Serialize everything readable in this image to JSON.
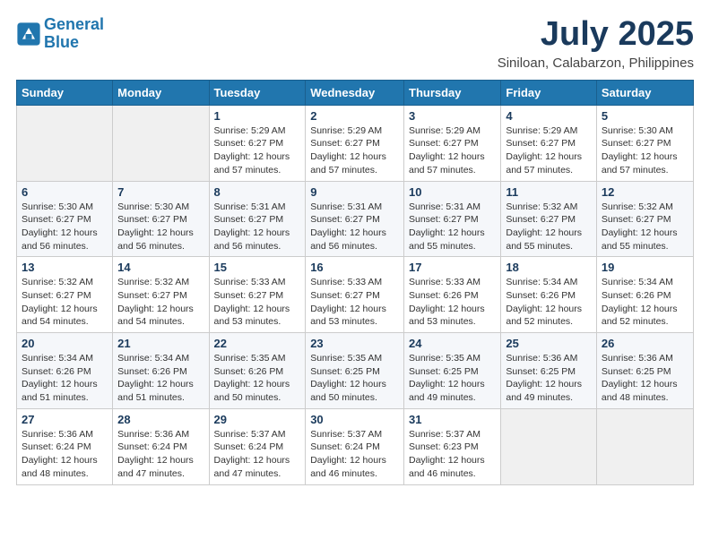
{
  "header": {
    "logo_line1": "General",
    "logo_line2": "Blue",
    "month": "July 2025",
    "location": "Siniloan, Calabarzon, Philippines"
  },
  "weekdays": [
    "Sunday",
    "Monday",
    "Tuesday",
    "Wednesday",
    "Thursday",
    "Friday",
    "Saturday"
  ],
  "weeks": [
    [
      {
        "day": "",
        "info": ""
      },
      {
        "day": "",
        "info": ""
      },
      {
        "day": "1",
        "info": "Sunrise: 5:29 AM\nSunset: 6:27 PM\nDaylight: 12 hours\nand 57 minutes."
      },
      {
        "day": "2",
        "info": "Sunrise: 5:29 AM\nSunset: 6:27 PM\nDaylight: 12 hours\nand 57 minutes."
      },
      {
        "day": "3",
        "info": "Sunrise: 5:29 AM\nSunset: 6:27 PM\nDaylight: 12 hours\nand 57 minutes."
      },
      {
        "day": "4",
        "info": "Sunrise: 5:29 AM\nSunset: 6:27 PM\nDaylight: 12 hours\nand 57 minutes."
      },
      {
        "day": "5",
        "info": "Sunrise: 5:30 AM\nSunset: 6:27 PM\nDaylight: 12 hours\nand 57 minutes."
      }
    ],
    [
      {
        "day": "6",
        "info": "Sunrise: 5:30 AM\nSunset: 6:27 PM\nDaylight: 12 hours\nand 56 minutes."
      },
      {
        "day": "7",
        "info": "Sunrise: 5:30 AM\nSunset: 6:27 PM\nDaylight: 12 hours\nand 56 minutes."
      },
      {
        "day": "8",
        "info": "Sunrise: 5:31 AM\nSunset: 6:27 PM\nDaylight: 12 hours\nand 56 minutes."
      },
      {
        "day": "9",
        "info": "Sunrise: 5:31 AM\nSunset: 6:27 PM\nDaylight: 12 hours\nand 56 minutes."
      },
      {
        "day": "10",
        "info": "Sunrise: 5:31 AM\nSunset: 6:27 PM\nDaylight: 12 hours\nand 55 minutes."
      },
      {
        "day": "11",
        "info": "Sunrise: 5:32 AM\nSunset: 6:27 PM\nDaylight: 12 hours\nand 55 minutes."
      },
      {
        "day": "12",
        "info": "Sunrise: 5:32 AM\nSunset: 6:27 PM\nDaylight: 12 hours\nand 55 minutes."
      }
    ],
    [
      {
        "day": "13",
        "info": "Sunrise: 5:32 AM\nSunset: 6:27 PM\nDaylight: 12 hours\nand 54 minutes."
      },
      {
        "day": "14",
        "info": "Sunrise: 5:32 AM\nSunset: 6:27 PM\nDaylight: 12 hours\nand 54 minutes."
      },
      {
        "day": "15",
        "info": "Sunrise: 5:33 AM\nSunset: 6:27 PM\nDaylight: 12 hours\nand 53 minutes."
      },
      {
        "day": "16",
        "info": "Sunrise: 5:33 AM\nSunset: 6:27 PM\nDaylight: 12 hours\nand 53 minutes."
      },
      {
        "day": "17",
        "info": "Sunrise: 5:33 AM\nSunset: 6:26 PM\nDaylight: 12 hours\nand 53 minutes."
      },
      {
        "day": "18",
        "info": "Sunrise: 5:34 AM\nSunset: 6:26 PM\nDaylight: 12 hours\nand 52 minutes."
      },
      {
        "day": "19",
        "info": "Sunrise: 5:34 AM\nSunset: 6:26 PM\nDaylight: 12 hours\nand 52 minutes."
      }
    ],
    [
      {
        "day": "20",
        "info": "Sunrise: 5:34 AM\nSunset: 6:26 PM\nDaylight: 12 hours\nand 51 minutes."
      },
      {
        "day": "21",
        "info": "Sunrise: 5:34 AM\nSunset: 6:26 PM\nDaylight: 12 hours\nand 51 minutes."
      },
      {
        "day": "22",
        "info": "Sunrise: 5:35 AM\nSunset: 6:26 PM\nDaylight: 12 hours\nand 50 minutes."
      },
      {
        "day": "23",
        "info": "Sunrise: 5:35 AM\nSunset: 6:25 PM\nDaylight: 12 hours\nand 50 minutes."
      },
      {
        "day": "24",
        "info": "Sunrise: 5:35 AM\nSunset: 6:25 PM\nDaylight: 12 hours\nand 49 minutes."
      },
      {
        "day": "25",
        "info": "Sunrise: 5:36 AM\nSunset: 6:25 PM\nDaylight: 12 hours\nand 49 minutes."
      },
      {
        "day": "26",
        "info": "Sunrise: 5:36 AM\nSunset: 6:25 PM\nDaylight: 12 hours\nand 48 minutes."
      }
    ],
    [
      {
        "day": "27",
        "info": "Sunrise: 5:36 AM\nSunset: 6:24 PM\nDaylight: 12 hours\nand 48 minutes."
      },
      {
        "day": "28",
        "info": "Sunrise: 5:36 AM\nSunset: 6:24 PM\nDaylight: 12 hours\nand 47 minutes."
      },
      {
        "day": "29",
        "info": "Sunrise: 5:37 AM\nSunset: 6:24 PM\nDaylight: 12 hours\nand 47 minutes."
      },
      {
        "day": "30",
        "info": "Sunrise: 5:37 AM\nSunset: 6:24 PM\nDaylight: 12 hours\nand 46 minutes."
      },
      {
        "day": "31",
        "info": "Sunrise: 5:37 AM\nSunset: 6:23 PM\nDaylight: 12 hours\nand 46 minutes."
      },
      {
        "day": "",
        "info": ""
      },
      {
        "day": "",
        "info": ""
      }
    ]
  ]
}
